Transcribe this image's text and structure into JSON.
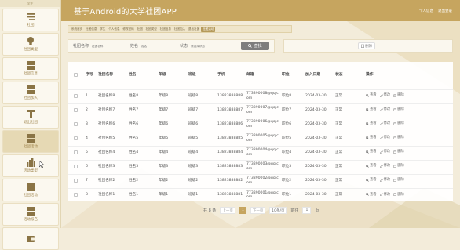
{
  "app_title": "基于Android的大学社团APP",
  "header_links": [
    "个人信息",
    "退出登录"
  ],
  "sidebar": {
    "top_label": "学生",
    "items": [
      {
        "label": "社团",
        "icon": "menu-lines-icon"
      },
      {
        "label": "社团类型",
        "icon": "bulb-icon"
      },
      {
        "label": "社团信息",
        "icon": "grid-icon"
      },
      {
        "label": "社团加入",
        "icon": "grid-icon"
      },
      {
        "label": "退出社团",
        "icon": "t-shape-icon"
      },
      {
        "label": "社团活动",
        "icon": "grid-icon"
      },
      {
        "label": "活动类型",
        "icon": "bar-chart-icon"
      },
      {
        "label": "社团活动",
        "icon": "grid-icon"
      },
      {
        "label": "活动报名",
        "icon": "grid-icon"
      },
      {
        "label": "",
        "icon": "wallet-icon"
      }
    ]
  },
  "tabs": [
    "系统首页",
    "社团信息",
    "学生",
    "个人信息",
    "修改密码",
    "社团",
    "社团类型",
    "社团信息",
    "社团加入",
    "退出社团",
    "社团活动"
  ],
  "search": {
    "label1": "社团名称",
    "placeholder1": "社团名称",
    "label2": "姓名",
    "placeholder2": "姓名",
    "label3": "状态",
    "placeholder3": "请选择状态",
    "button": "查找",
    "button_icon": "search-icon"
  },
  "actions": {
    "delete_label": "删除",
    "delete_icon": "trash-icon"
  },
  "table": {
    "headers": [
      "序号",
      "社团名称",
      "姓名",
      "年级",
      "班级",
      "手机",
      "邮箱",
      "职位",
      "加入日期",
      "状态",
      "操作"
    ],
    "rows": [
      [
        "1",
        "社团名称8",
        "姓名8",
        "年级8",
        "班级8",
        "13823888888",
        "773890008@qq.com",
        "职位8",
        "2024-03-30",
        "正常"
      ],
      [
        "2",
        "社团名称7",
        "姓名7",
        "年级7",
        "班级7",
        "13823888887",
        "773890007@qq.com",
        "职位7",
        "2024-03-30",
        "正常"
      ],
      [
        "3",
        "社团名称6",
        "姓名6",
        "年级6",
        "班级6",
        "13823888886",
        "773890006@qq.com",
        "职位6",
        "2024-03-30",
        "正常"
      ],
      [
        "4",
        "社团名称5",
        "姓名5",
        "年级5",
        "班级5",
        "13823888885",
        "773890005@qq.com",
        "职位5",
        "2024-03-30",
        "正常"
      ],
      [
        "5",
        "社团名称4",
        "姓名4",
        "年级4",
        "班级4",
        "13823888884",
        "773890004@qq.com",
        "职位4",
        "2024-03-30",
        "正常"
      ],
      [
        "6",
        "社团名称3",
        "姓名3",
        "年级3",
        "班级3",
        "13823888883",
        "773890003@qq.com",
        "职位3",
        "2024-03-30",
        "正常"
      ],
      [
        "7",
        "社团名称2",
        "姓名2",
        "年级2",
        "班级2",
        "13823888882",
        "773890002@qq.com",
        "职位2",
        "2024-03-30",
        "正常"
      ],
      [
        "8",
        "社团名称1",
        "姓名1",
        "年级1",
        "班级1",
        "13823888881",
        "773890001@qq.com",
        "职位1",
        "2024-03-30",
        "正常"
      ]
    ],
    "op_view": "查看",
    "op_edit": "修改",
    "op_delete": "删除"
  },
  "pagination": {
    "total": "共 8 条",
    "prev": "上一页",
    "current_page": "1",
    "next": "下一页",
    "page_size": "10条/页",
    "goto_label": "前往",
    "goto_value": "1",
    "page_suffix": "页"
  },
  "colors": {
    "accent": "#c6a55f",
    "sidebar_icon": "#8a7445",
    "search_button": "#7d7d7d"
  }
}
